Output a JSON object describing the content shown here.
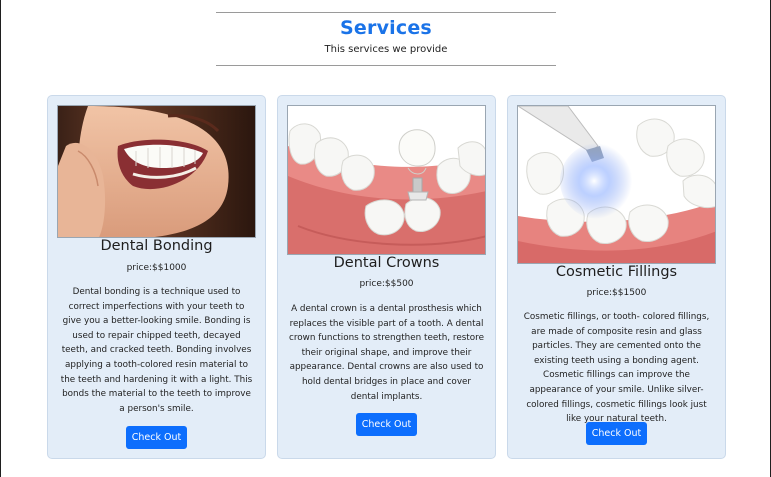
{
  "section": {
    "title": "Services",
    "subtitle": "This services we provide"
  },
  "cards": [
    {
      "title": "Dental Bonding",
      "price": "price:$$1000",
      "description": "Dental bonding is a technique used to correct imperfections with your teeth to give you a better-looking smile. Bonding is used to repair chipped teeth, decayed teeth, and cracked teeth. Bonding involves applying a tooth-colored resin material to the teeth and hardening it with a light. This bonds the material to the teeth to improve a person's smile.",
      "button_label": "Check Out",
      "image": "smiling-woman-photo"
    },
    {
      "title": "Dental Crowns",
      "price": "price:$$500",
      "description": "A dental crown is a dental prosthesis which replaces the visible part of a tooth. A dental crown functions to strengthen teeth, restore their original shape, and improve their appearance. Dental crowns are also used to hold dental bridges in place and cover dental implants.",
      "button_label": "Check Out",
      "image": "dental-crown-illustration"
    },
    {
      "title": "Cosmetic Fillings",
      "price": "price:$$1500",
      "description": "Cosmetic fillings, or tooth- colored fillings, are made of composite resin and glass particles. They are cemented onto the existing teeth using a bonding agent. Cosmetic fillings can improve the appearance of your smile. Unlike silver-colored fillings, cosmetic fillings look just like your natural teeth.",
      "button_label": "Check Out",
      "image": "curing-light-illustration"
    }
  ],
  "colors": {
    "accent": "#1a73e8",
    "button": "#0d6efd",
    "card_bg": "#e3edf8"
  }
}
